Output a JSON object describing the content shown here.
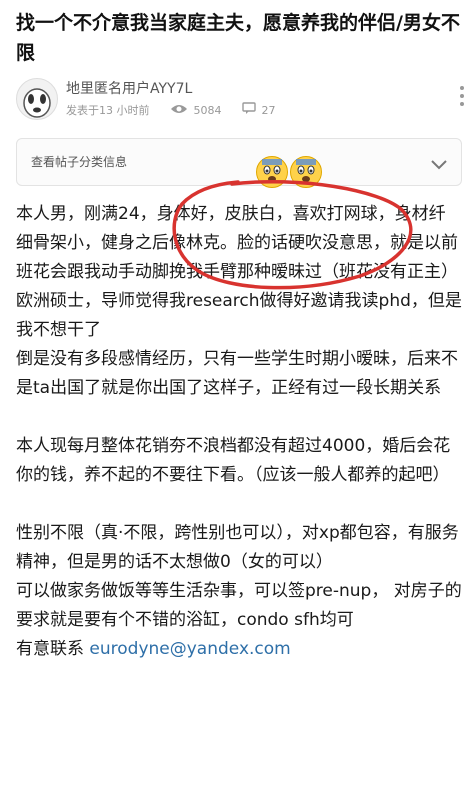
{
  "post": {
    "title": "找一个不介意我当家庭主夫，愿意养我的伴侣/男女不限"
  },
  "author": {
    "name": "地里匿名用户AYY7L",
    "posted_time": "发表于13 小时前",
    "views": "5084",
    "comments": "27"
  },
  "category": {
    "label": "查看帖子分类信息"
  },
  "icons": {
    "views": "eye-icon",
    "comments": "comment-icon",
    "more": "more-vertical-icon",
    "expand": "chevron-down-icon",
    "emoji": "fearful-face-emoji"
  },
  "content": {
    "p1": "本人男，刚满24，身体好，皮肤白，喜欢打网球，身材纤细骨架小，健身之后像林克。脸的话硬吹没意思，就是以前班花会跟我动手动脚挽我手臂那种暧昧过（班花没有正主）",
    "p2": "欧洲硕士，导师觉得我research做得好邀请我读phd，但是我不想干了",
    "p3": "倒是没有多段感情经历，只有一些学生时期小暧昧，后来不是ta出国了就是你出国了这样子，正经有过一段长期关系",
    "p4": "本人现每月整体花销夯不浪档都没有超过4000，婚后会花你的钱，养不起的不要往下看。（应该一般人都养的起吧）",
    "p5": "性别不限（真·不限，跨性别也可以），对xp都包容，有服务精神，但是男的话不太想做0（女的可以）",
    "p6": "可以做家务做饭等等生活杂事，可以签pre-nup， 对房子的要求就是要有个不错的浴缸，condo sfh均可",
    "p7_prefix": "有意联系 ",
    "email": "eurodyne@yandex.com"
  },
  "colors": {
    "annotation_red": "#d8332f",
    "link": "#2e6fa8"
  }
}
